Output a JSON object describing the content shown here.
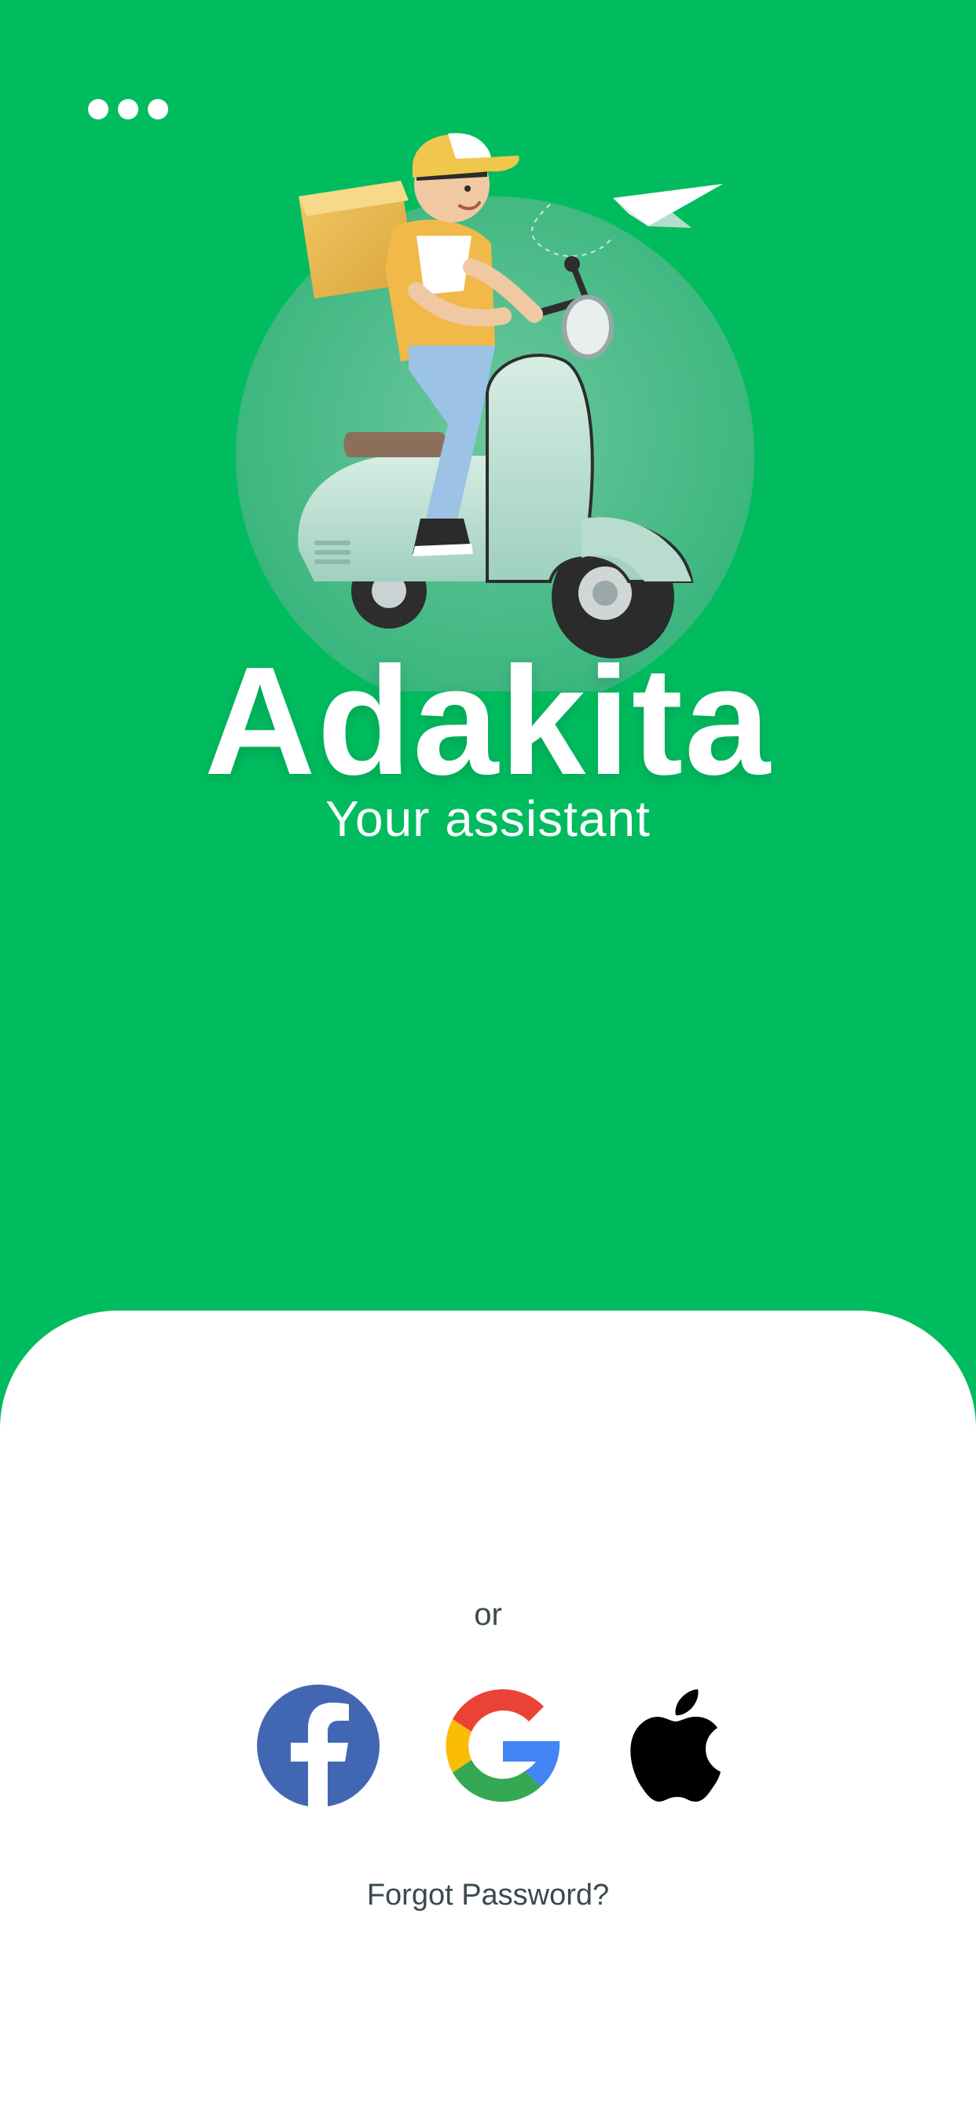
{
  "app": {
    "name": "Adakita",
    "tagline": "Your assistant"
  },
  "colors": {
    "background": "#00BC5F",
    "sheet": "#FFFFFF",
    "text_dark": "#3B4A4F"
  },
  "header": {
    "menu_icon": "more-dots-icon"
  },
  "hero": {
    "illustration": "delivery-rider-on-scooter",
    "accent_icon": "paper-plane-icon"
  },
  "login": {
    "divider_text": "or",
    "social": [
      {
        "icon": "facebook-icon"
      },
      {
        "icon": "google-icon"
      },
      {
        "icon": "apple-icon"
      }
    ],
    "forgot_password": "Forgot Password?"
  }
}
